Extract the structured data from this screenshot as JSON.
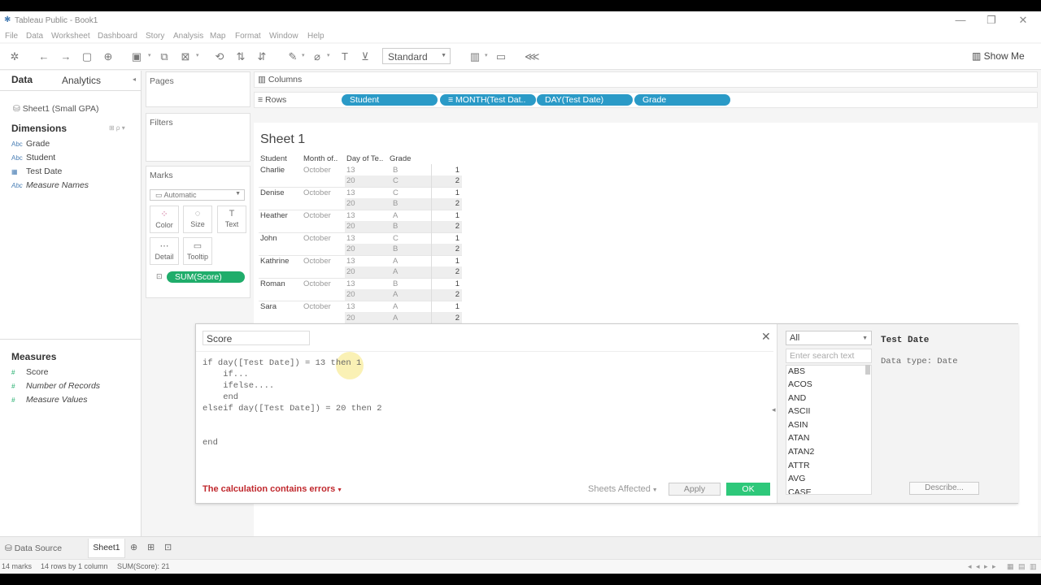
{
  "window": {
    "title": "Tableau Public - Book1",
    "controls": [
      "—",
      "❐",
      "✕"
    ]
  },
  "menu": [
    "File",
    "Data",
    "Worksheet",
    "Dashboard",
    "Story",
    "Analysis",
    "Map",
    "Format",
    "Window",
    "Help"
  ],
  "toolbar": {
    "view_size": "Standard",
    "show_me": "Show Me"
  },
  "datapane": {
    "tab_data": "Data",
    "tab_analytics": "Analytics",
    "datasource": "Sheet1 (Small GPA)",
    "dimensions_header": "Dimensions",
    "dimensions": [
      {
        "icon": "Abc",
        "label": "Grade"
      },
      {
        "icon": "Abc",
        "label": "Student"
      },
      {
        "icon": "▦",
        "label": "Test Date"
      },
      {
        "icon": "Abc",
        "label": "Measure Names"
      }
    ],
    "measures_header": "Measures",
    "measures": [
      {
        "icon": "#",
        "label": "Score"
      },
      {
        "icon": "#",
        "label": "Number of Records"
      },
      {
        "icon": "#",
        "label": "Measure Values"
      }
    ]
  },
  "shelves": {
    "pages": "Pages",
    "filters": "Filters",
    "marks": "Marks",
    "mark_type": "Automatic",
    "mark_buttons": [
      {
        "icon": "⁘",
        "label": "Color"
      },
      {
        "icon": "◌",
        "label": "Size"
      },
      {
        "icon": "T",
        "label": "Text"
      },
      {
        "icon": "⋯",
        "label": "Detail"
      },
      {
        "icon": "▭",
        "label": "Tooltip"
      }
    ],
    "mark_pill": "SUM(Score)",
    "columns_label": "Columns",
    "rows_label": "Rows",
    "row_pills": [
      "Student",
      "≡ MONTH(Test Dat..",
      "DAY(Test Date)",
      "Grade"
    ]
  },
  "sheet": {
    "title": "Sheet 1",
    "headers": [
      "Student",
      "Month of..",
      "Day of Te..",
      "Grade"
    ],
    "rows": [
      {
        "student": "Charlie",
        "month": "October",
        "day": "13",
        "grade": "B",
        "value": "1"
      },
      {
        "student": "",
        "month": "",
        "day": "20",
        "grade": "C",
        "value": "2"
      },
      {
        "student": "Denise",
        "month": "October",
        "day": "13",
        "grade": "C",
        "value": "1"
      },
      {
        "student": "",
        "month": "",
        "day": "20",
        "grade": "B",
        "value": "2"
      },
      {
        "student": "Heather",
        "month": "October",
        "day": "13",
        "grade": "A",
        "value": "1"
      },
      {
        "student": "",
        "month": "",
        "day": "20",
        "grade": "B",
        "value": "2"
      },
      {
        "student": "John",
        "month": "October",
        "day": "13",
        "grade": "C",
        "value": "1"
      },
      {
        "student": "",
        "month": "",
        "day": "20",
        "grade": "B",
        "value": "2"
      },
      {
        "student": "Kathrine",
        "month": "October",
        "day": "13",
        "grade": "A",
        "value": "1"
      },
      {
        "student": "",
        "month": "",
        "day": "20",
        "grade": "A",
        "value": "2"
      },
      {
        "student": "Roman",
        "month": "October",
        "day": "13",
        "grade": "B",
        "value": "1"
      },
      {
        "student": "",
        "month": "",
        "day": "20",
        "grade": "A",
        "value": "2"
      },
      {
        "student": "Sara",
        "month": "October",
        "day": "13",
        "grade": "A",
        "value": "1"
      },
      {
        "student": "",
        "month": "",
        "day": "20",
        "grade": "A",
        "value": "2"
      }
    ]
  },
  "calc": {
    "name": "Score",
    "code_lines": [
      "if day([Test Date]) = 13 then 1",
      "    if...",
      "    ifelse....",
      "    end",
      "elseif day([Test Date]) = 20 then 2",
      "",
      "",
      "end"
    ],
    "error": "The calculation contains errors",
    "sheets_affected": "Sheets Affected",
    "apply": "Apply",
    "ok": "OK",
    "func_filter": "All",
    "search_placeholder": "Enter search text",
    "functions": [
      "ABS",
      "ACOS",
      "AND",
      "ASCII",
      "ASIN",
      "ATAN",
      "ATAN2",
      "ATTR",
      "AVG",
      "CASE"
    ],
    "field_title": "Test Date",
    "field_desc": "Data type: Date",
    "describe": "Describe..."
  },
  "bottom": {
    "data_source": "Data Source",
    "sheet_tab": "Sheet1"
  },
  "status": {
    "marks": "14 marks",
    "dims": "14 rows by 1 column",
    "sum": "SUM(Score): 21"
  }
}
